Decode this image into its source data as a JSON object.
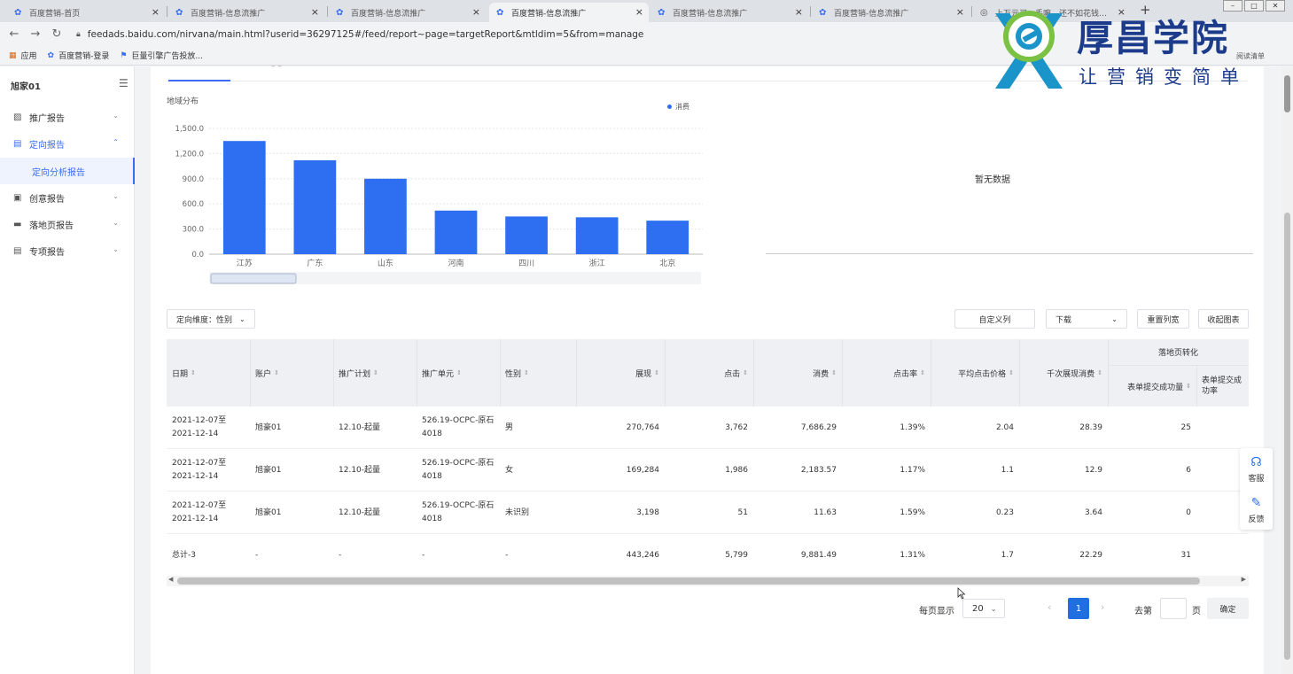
{
  "browser": {
    "tabs": [
      {
        "label": "百度营销-首页",
        "active": false
      },
      {
        "label": "百度营销-信息流推广",
        "active": false
      },
      {
        "label": "百度营销-信息流推广",
        "active": false
      },
      {
        "label": "百度营销-信息流推广",
        "active": true
      },
      {
        "label": "百度营销-信息流推广",
        "active": false
      },
      {
        "label": "百度营销-信息流推广",
        "active": false
      },
      {
        "label": "上万元买…手嘛，还不如花钱…",
        "active": false
      }
    ],
    "new_tab": "+",
    "close_glyph": "×",
    "url": "feedads.baidu.com/nirvana/main.html?userid=36297125#/feed/report~page=targetReport&mtldim=5&from=manage",
    "bookmarks": [
      {
        "label": "应用",
        "icon": "apps-grid-icon"
      },
      {
        "label": "百度营销-登录",
        "icon": "paw-icon"
      },
      {
        "label": "巨量引擎广告投放...",
        "icon": "flag-icon"
      }
    ],
    "reading_list": "阅读清单"
  },
  "watermark": {
    "brand": "厚昌学院",
    "slogan": "让营销变简单"
  },
  "sidebar": {
    "account": "旭家01",
    "items": [
      {
        "label": "推广报告",
        "icon": "chart-icon",
        "expanded": false
      },
      {
        "label": "定向报告",
        "icon": "target-report-icon",
        "expanded": true
      },
      {
        "label": "定向分析报告",
        "icon": "",
        "sub": true
      },
      {
        "label": "创意报告",
        "icon": "creative-icon",
        "expanded": false
      },
      {
        "label": "落地页报告",
        "icon": "landing-page-icon",
        "expanded": false
      },
      {
        "label": "专项报告",
        "icon": "special-report-icon",
        "expanded": false
      }
    ]
  },
  "chart_section": {
    "title": "地域分布",
    "no_data": "暂无数据"
  },
  "chart_data": {
    "type": "bar",
    "categories": [
      "江苏",
      "广东",
      "山东",
      "河南",
      "四川",
      "浙江",
      "北京"
    ],
    "series": [
      {
        "name": "消费",
        "values": [
          1350,
          1120,
          900,
          520,
          450,
          440,
          400
        ],
        "color": "#2e6ff2"
      }
    ],
    "yticks": [
      "0.0",
      "300.0",
      "600.0",
      "900.0",
      "1,200.0",
      "1,500.0"
    ],
    "ylim": [
      0,
      1500
    ],
    "grid": true,
    "legend": "top-right"
  },
  "toolbar": {
    "dimension_select": "定向维度：性别",
    "custom_columns": "自定义列",
    "download": "下载",
    "reset_width": "重置列宽",
    "collapse_chart": "收起图表"
  },
  "table": {
    "group_header": "落地页转化",
    "columns": [
      "日期",
      "账户",
      "推广计划",
      "推广单元",
      "性别",
      "展现",
      "点击",
      "消费",
      "点击率",
      "平均点击价格",
      "千次展现消费",
      "表单提交成功量",
      "表单提交成功率"
    ],
    "sort_glyph": "⇕",
    "rows": [
      [
        "2021-12-07至2021-12-14",
        "旭豪01",
        "12.10-起量",
        "526.19-OCPC-原石4018",
        "男",
        "270,764",
        "3,762",
        "7,686.29",
        "1.39%",
        "2.04",
        "28.39",
        "25",
        ""
      ],
      [
        "2021-12-07至2021-12-14",
        "旭豪01",
        "12.10-起量",
        "526.19-OCPC-原石4018",
        "女",
        "169,284",
        "1,986",
        "2,183.57",
        "1.17%",
        "1.1",
        "12.9",
        "6",
        ""
      ],
      [
        "2021-12-07至2021-12-14",
        "旭豪01",
        "12.10-起量",
        "526.19-OCPC-原石4018",
        "未识别",
        "3,198",
        "51",
        "11.63",
        "1.59%",
        "0.23",
        "3.64",
        "0",
        ""
      ]
    ],
    "total": [
      "总计-3",
      "-",
      "-",
      "-",
      "-",
      "443,246",
      "5,799",
      "9,881.49",
      "1.31%",
      "1.7",
      "22.29",
      "31",
      ""
    ]
  },
  "pager": {
    "page_size_label": "每页显示",
    "page_size": "20",
    "prev": "‹",
    "current_page": "1",
    "next": "›",
    "goto_label": "去第",
    "goto_unit": "页",
    "confirm": "确定"
  },
  "float_tools": [
    {
      "label": "客服",
      "icon": "headset-icon"
    },
    {
      "label": "反馈",
      "icon": "feedback-pen-icon"
    }
  ],
  "colors": {
    "accent": "#2e6ff2",
    "brand": "#1c3b8a",
    "page_button": "#1f6fe0"
  }
}
